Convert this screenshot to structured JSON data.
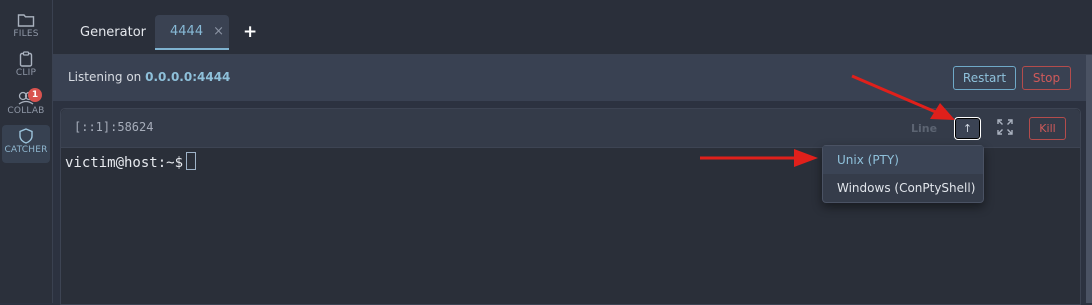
{
  "sidebar": {
    "items": [
      {
        "label": "FILES",
        "icon": "folder-icon"
      },
      {
        "label": "CLIP",
        "icon": "clipboard-icon"
      },
      {
        "label": "COLLAB",
        "icon": "collab-icon",
        "badge": "1"
      },
      {
        "label": "CATCHER",
        "icon": "shield-icon",
        "active": true
      }
    ]
  },
  "tabs": [
    {
      "label": "Generator"
    },
    {
      "label": "4444",
      "close": "×",
      "active": true
    }
  ],
  "add_tab": "+",
  "listener": {
    "prefix": "Listening on",
    "address": "0.0.0.0:4444",
    "restart_label": "Restart",
    "stop_label": "Stop"
  },
  "session": {
    "peer": "[::1]:58624",
    "line_label": "Line",
    "upgrade_label": "↑",
    "expand_icon": "expand-icon",
    "kill_label": "Kill",
    "prompt": "victim@host:~$"
  },
  "dropdown": {
    "options": [
      "Unix (PTY)",
      "Windows (ConPtyShell)"
    ]
  },
  "colors": {
    "accent": "#8fc1db",
    "danger": "#d05a5a",
    "annotation_arrow": "#e0201b"
  }
}
